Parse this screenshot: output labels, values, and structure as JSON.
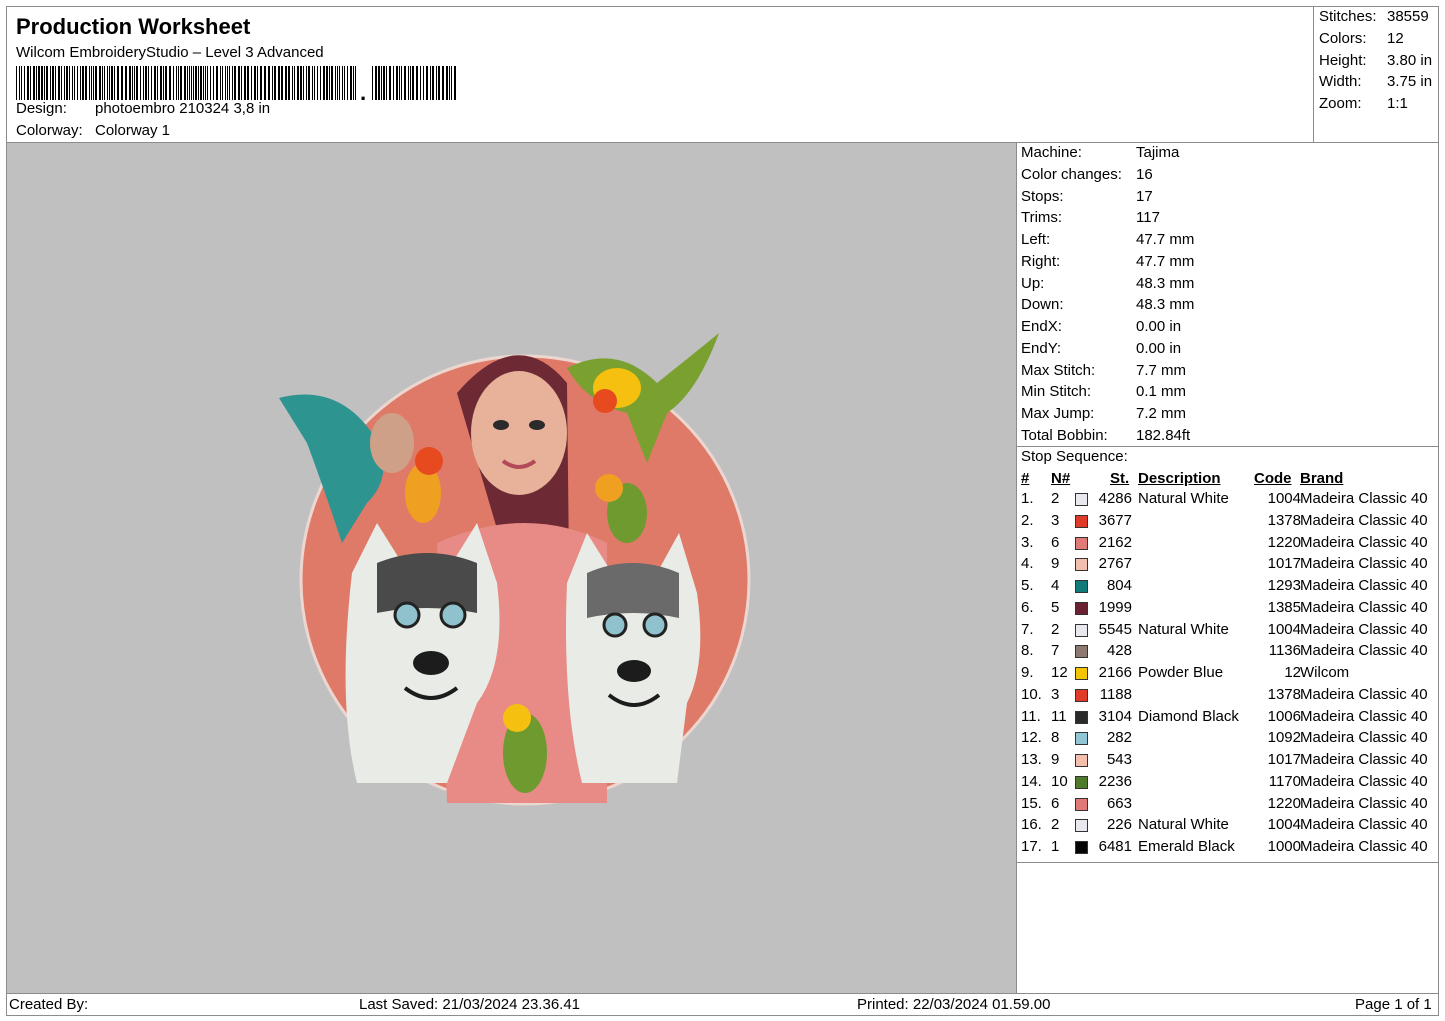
{
  "header": {
    "title": "Production Worksheet",
    "software": "Wilcom EmbroideryStudio – Level 3 Advanced",
    "design_label": "Design:",
    "design_value": "photoembro 210324 3,8 in",
    "colorway_label": "Colorway:",
    "colorway_value": "Colorway 1"
  },
  "stats": {
    "stitches_label": "Stitches:",
    "stitches": "38559",
    "colors_label": "Colors:",
    "colors": "12",
    "height_label": "Height:",
    "height": "3.80 in",
    "width_label": "Width:",
    "width": "3.75 in",
    "zoom_label": "Zoom:",
    "zoom": "1:1"
  },
  "machine_info": [
    {
      "label": "Machine:",
      "value": "Tajima"
    },
    {
      "label": "Color changes:",
      "value": "16"
    },
    {
      "label": "Stops:",
      "value": "17"
    },
    {
      "label": "Trims:",
      "value": "117"
    },
    {
      "label": "Left:",
      "value": "47.7 mm"
    },
    {
      "label": "Right:",
      "value": "47.7 mm"
    },
    {
      "label": "Up:",
      "value": "48.3 mm"
    },
    {
      "label": "Down:",
      "value": "48.3 mm"
    },
    {
      "label": "EndX:",
      "value": "0.00 in"
    },
    {
      "label": "EndY:",
      "value": "0.00 in"
    },
    {
      "label": "Max Stitch:",
      "value": "7.7 mm"
    },
    {
      "label": "Min Stitch:",
      "value": "0.1 mm"
    },
    {
      "label": "Max Jump:",
      "value": "7.2 mm"
    },
    {
      "label": "Total Bobbin:",
      "value": "182.84ft"
    }
  ],
  "stop_sequence": {
    "title": "Stop Sequence:",
    "headers": {
      "idx": "#",
      "n": "N#",
      "st": "St.",
      "desc": "Description",
      "code": "Code",
      "brand": "Brand"
    },
    "rows": [
      {
        "idx": "1.",
        "n": "2",
        "color": "#e8e8ee",
        "st": "4286",
        "desc": "Natural White",
        "code": "1004",
        "brand": "Madeira Classic 40"
      },
      {
        "idx": "2.",
        "n": "3",
        "color": "#e03a28",
        "st": "3677",
        "desc": "",
        "code": "1378",
        "brand": "Madeira Classic 40"
      },
      {
        "idx": "3.",
        "n": "6",
        "color": "#e07a78",
        "st": "2162",
        "desc": "",
        "code": "1220",
        "brand": "Madeira Classic 40"
      },
      {
        "idx": "4.",
        "n": "9",
        "color": "#f2bfae",
        "st": "2767",
        "desc": "",
        "code": "1017",
        "brand": "Madeira Classic 40"
      },
      {
        "idx": "5.",
        "n": "4",
        "color": "#127a78",
        "st": "804",
        "desc": "",
        "code": "1293",
        "brand": "Madeira Classic 40"
      },
      {
        "idx": "6.",
        "n": "5",
        "color": "#6a2232",
        "st": "1999",
        "desc": "",
        "code": "1385",
        "brand": "Madeira Classic 40"
      },
      {
        "idx": "7.",
        "n": "2",
        "color": "#e8e8ee",
        "st": "5545",
        "desc": "Natural White",
        "code": "1004",
        "brand": "Madeira Classic 40"
      },
      {
        "idx": "8.",
        "n": "7",
        "color": "#8c7a70",
        "st": "428",
        "desc": "",
        "code": "1136",
        "brand": "Madeira Classic 40"
      },
      {
        "idx": "9.",
        "n": "12",
        "color": "#f5c400",
        "st": "2166",
        "desc": "Powder Blue",
        "code": "12",
        "brand": "Wilcom"
      },
      {
        "idx": "10.",
        "n": "3",
        "color": "#e03a28",
        "st": "1188",
        "desc": "",
        "code": "1378",
        "brand": "Madeira Classic 40"
      },
      {
        "idx": "11.",
        "n": "11",
        "color": "#2b2b2b",
        "st": "3104",
        "desc": "Diamond Black",
        "code": "1006",
        "brand": "Madeira Classic 40"
      },
      {
        "idx": "12.",
        "n": "8",
        "color": "#93c6d4",
        "st": "282",
        "desc": "",
        "code": "1092",
        "brand": "Madeira Classic 40"
      },
      {
        "idx": "13.",
        "n": "9",
        "color": "#f2bfae",
        "st": "543",
        "desc": "",
        "code": "1017",
        "brand": "Madeira Classic 40"
      },
      {
        "idx": "14.",
        "n": "10",
        "color": "#4f7a2a",
        "st": "2236",
        "desc": "",
        "code": "1170",
        "brand": "Madeira Classic 40"
      },
      {
        "idx": "15.",
        "n": "6",
        "color": "#e07a78",
        "st": "663",
        "desc": "",
        "code": "1220",
        "brand": "Madeira Classic 40"
      },
      {
        "idx": "16.",
        "n": "2",
        "color": "#e8e8ee",
        "st": "226",
        "desc": "Natural White",
        "code": "1004",
        "brand": "Madeira Classic 40"
      },
      {
        "idx": "17.",
        "n": "1",
        "color": "#050505",
        "st": "6481",
        "desc": "Emerald Black",
        "code": "1000",
        "brand": "Madeira Classic 40"
      }
    ]
  },
  "footer": {
    "created_by": "Created By:",
    "last_saved": "Last Saved: 21/03/2024 23.36.41",
    "printed": "Printed: 22/03/2024 01.59.00",
    "page": "Page 1 of 1"
  },
  "colors": {
    "canvas_bg": "#c0c0c0",
    "circle": "#e07a68",
    "border": "#8c8c8c"
  }
}
